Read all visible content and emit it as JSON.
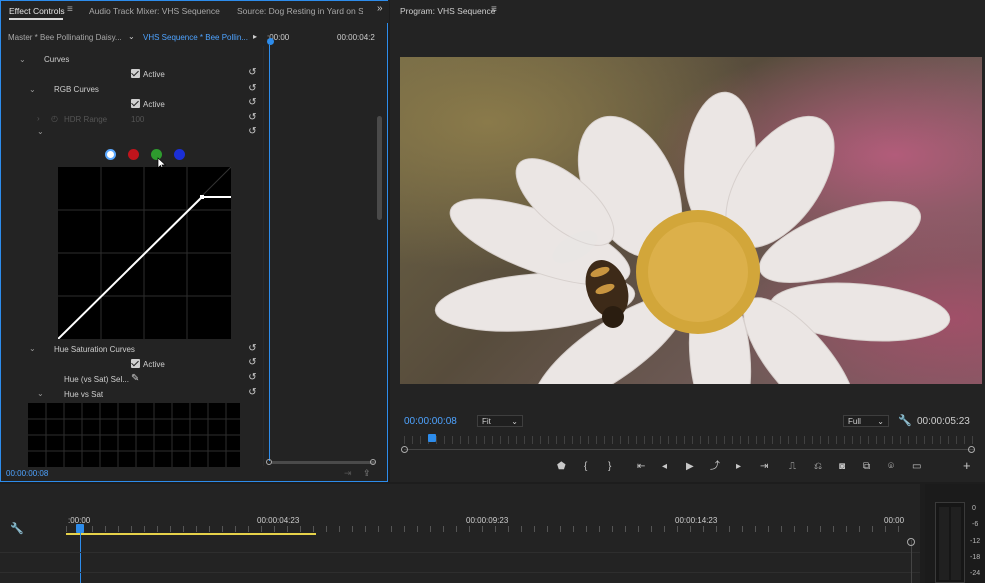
{
  "effect_controls": {
    "tabs": [
      "Effect Controls",
      "Audio Track Mixer: VHS Sequence",
      "Source: Dog Resting in Yard on Suni"
    ],
    "master_clip": "Master * Bee Pollinating Daisy...",
    "sequence_clip": "VHS Sequence * Bee Pollin...",
    "ruler_start": ":00:00",
    "ruler_end": "00:00:04:2",
    "curves_label": "Curves",
    "active_label": "Active",
    "rgb_curves_label": "RGB Curves",
    "hdr_range_label": "HDR Range",
    "hdr_range_value": "100",
    "hue_sat_curves_label": "Hue Saturation Curves",
    "hue_vs_sat_sel_label": "Hue (vs Sat) Sel...",
    "hue_vs_sat_label": "Hue vs Sat",
    "timecode": "00:00:00:08",
    "channel_colors": [
      "#ffffff",
      "#c0141c",
      "#2e9b2e",
      "#1b2fd6"
    ]
  },
  "program_monitor": {
    "title": "Program: VHS Sequence",
    "current_timecode": "00:00:00:08",
    "zoom_value": "Fit",
    "resolution_value": "Full",
    "duration": "00:00:05:23"
  },
  "timeline": {
    "ruler_labels": [
      ":00:00",
      "00:00:04:23",
      "00:00:09:23",
      "00:00:14:23",
      "00:00"
    ],
    "meter_labels": [
      "0",
      "-6",
      "-12",
      "-18",
      "-24"
    ]
  }
}
